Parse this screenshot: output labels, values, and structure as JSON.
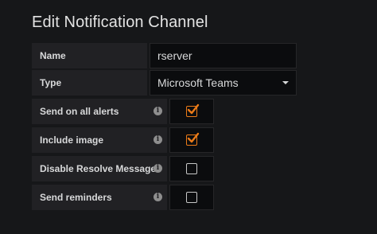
{
  "page": {
    "title": "Edit Notification Channel"
  },
  "fields": {
    "name": {
      "label": "Name",
      "value": "rserver"
    },
    "type": {
      "label": "Type",
      "selected": "Microsoft Teams"
    }
  },
  "toggles": [
    {
      "label": "Send on all alerts",
      "checked": true
    },
    {
      "label": "Include image",
      "checked": true
    },
    {
      "label": "Disable Resolve Message",
      "checked": false
    },
    {
      "label": "Send reminders",
      "checked": false
    }
  ],
  "colors": {
    "background": "#161719",
    "label_bg": "#212124",
    "input_bg": "#0b0c0e",
    "accent": "#eb7b18"
  },
  "icons": {
    "info": "info-icon",
    "caret": "chevron-down-icon",
    "check": "checkmark-icon"
  }
}
